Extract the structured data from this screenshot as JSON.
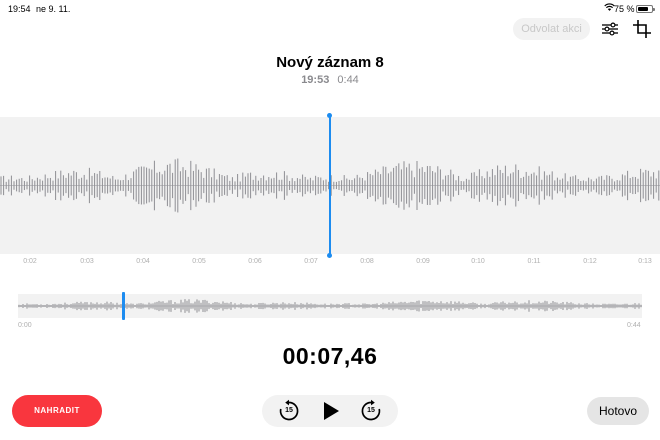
{
  "status_bar": {
    "time": "19:54",
    "date": "ne 9. 11.",
    "battery_percent": "75 %",
    "battery_level": 0.75,
    "wifi_icon": "wifi-icon"
  },
  "toolbar": {
    "undo_label": "Odvolat akci",
    "undo_enabled": false,
    "settings_icon": "sliders-icon",
    "crop_icon": "crop-trim-icon"
  },
  "recording": {
    "title": "Nový záznam 8",
    "recorded_at": "19:53",
    "duration": "0:44"
  },
  "timeline": {
    "tick_labels": [
      "0:02",
      "0:03",
      "0:04",
      "0:05",
      "0:06",
      "0:07",
      "0:08",
      "0:09",
      "0:10",
      "0:11",
      "0:12",
      "0:13"
    ],
    "playhead_seconds": 7.46
  },
  "overview": {
    "start_label": "0:00",
    "end_label": "0:44",
    "playhead_fraction": 0.17
  },
  "player": {
    "current_time": "00:07,46",
    "skip_back_seconds": "15",
    "skip_forward_seconds": "15",
    "play_icon": "play-icon"
  },
  "actions": {
    "replace_label": "NAHRADIT",
    "done_label": "Hotovo"
  },
  "colors": {
    "accent_blue": "#1d8cf0",
    "record_red": "#f9363e",
    "waveform_gray": "#8e8e93",
    "panel_bg": "#f2f2f2"
  }
}
